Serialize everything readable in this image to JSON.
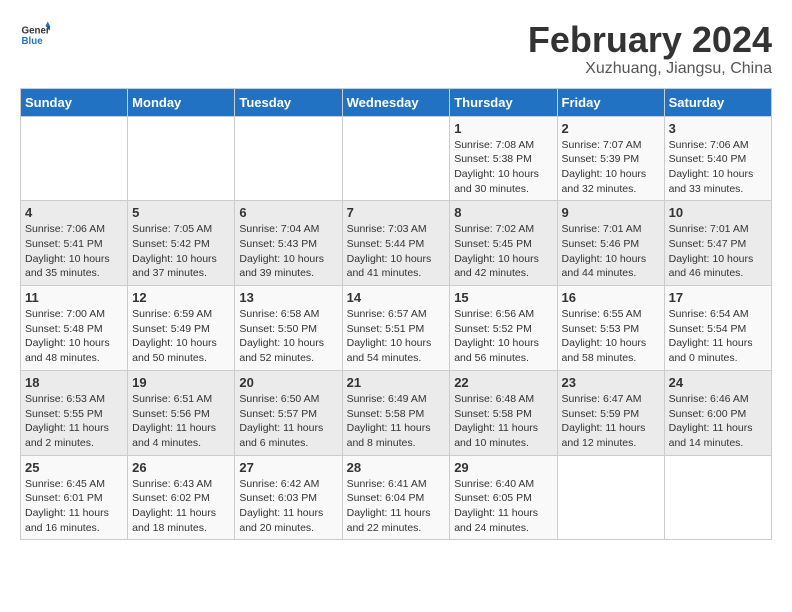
{
  "logo": {
    "text_general": "General",
    "text_blue": "Blue"
  },
  "header": {
    "title": "February 2024",
    "subtitle": "Xuzhuang, Jiangsu, China"
  },
  "days_of_week": [
    "Sunday",
    "Monday",
    "Tuesday",
    "Wednesday",
    "Thursday",
    "Friday",
    "Saturday"
  ],
  "weeks": [
    [
      {
        "day": "",
        "info": ""
      },
      {
        "day": "",
        "info": ""
      },
      {
        "day": "",
        "info": ""
      },
      {
        "day": "",
        "info": ""
      },
      {
        "day": "1",
        "info": "Sunrise: 7:08 AM\nSunset: 5:38 PM\nDaylight: 10 hours\nand 30 minutes."
      },
      {
        "day": "2",
        "info": "Sunrise: 7:07 AM\nSunset: 5:39 PM\nDaylight: 10 hours\nand 32 minutes."
      },
      {
        "day": "3",
        "info": "Sunrise: 7:06 AM\nSunset: 5:40 PM\nDaylight: 10 hours\nand 33 minutes."
      }
    ],
    [
      {
        "day": "4",
        "info": "Sunrise: 7:06 AM\nSunset: 5:41 PM\nDaylight: 10 hours\nand 35 minutes."
      },
      {
        "day": "5",
        "info": "Sunrise: 7:05 AM\nSunset: 5:42 PM\nDaylight: 10 hours\nand 37 minutes."
      },
      {
        "day": "6",
        "info": "Sunrise: 7:04 AM\nSunset: 5:43 PM\nDaylight: 10 hours\nand 39 minutes."
      },
      {
        "day": "7",
        "info": "Sunrise: 7:03 AM\nSunset: 5:44 PM\nDaylight: 10 hours\nand 41 minutes."
      },
      {
        "day": "8",
        "info": "Sunrise: 7:02 AM\nSunset: 5:45 PM\nDaylight: 10 hours\nand 42 minutes."
      },
      {
        "day": "9",
        "info": "Sunrise: 7:01 AM\nSunset: 5:46 PM\nDaylight: 10 hours\nand 44 minutes."
      },
      {
        "day": "10",
        "info": "Sunrise: 7:01 AM\nSunset: 5:47 PM\nDaylight: 10 hours\nand 46 minutes."
      }
    ],
    [
      {
        "day": "11",
        "info": "Sunrise: 7:00 AM\nSunset: 5:48 PM\nDaylight: 10 hours\nand 48 minutes."
      },
      {
        "day": "12",
        "info": "Sunrise: 6:59 AM\nSunset: 5:49 PM\nDaylight: 10 hours\nand 50 minutes."
      },
      {
        "day": "13",
        "info": "Sunrise: 6:58 AM\nSunset: 5:50 PM\nDaylight: 10 hours\nand 52 minutes."
      },
      {
        "day": "14",
        "info": "Sunrise: 6:57 AM\nSunset: 5:51 PM\nDaylight: 10 hours\nand 54 minutes."
      },
      {
        "day": "15",
        "info": "Sunrise: 6:56 AM\nSunset: 5:52 PM\nDaylight: 10 hours\nand 56 minutes."
      },
      {
        "day": "16",
        "info": "Sunrise: 6:55 AM\nSunset: 5:53 PM\nDaylight: 10 hours\nand 58 minutes."
      },
      {
        "day": "17",
        "info": "Sunrise: 6:54 AM\nSunset: 5:54 PM\nDaylight: 11 hours\nand 0 minutes."
      }
    ],
    [
      {
        "day": "18",
        "info": "Sunrise: 6:53 AM\nSunset: 5:55 PM\nDaylight: 11 hours\nand 2 minutes."
      },
      {
        "day": "19",
        "info": "Sunrise: 6:51 AM\nSunset: 5:56 PM\nDaylight: 11 hours\nand 4 minutes."
      },
      {
        "day": "20",
        "info": "Sunrise: 6:50 AM\nSunset: 5:57 PM\nDaylight: 11 hours\nand 6 minutes."
      },
      {
        "day": "21",
        "info": "Sunrise: 6:49 AM\nSunset: 5:58 PM\nDaylight: 11 hours\nand 8 minutes."
      },
      {
        "day": "22",
        "info": "Sunrise: 6:48 AM\nSunset: 5:58 PM\nDaylight: 11 hours\nand 10 minutes."
      },
      {
        "day": "23",
        "info": "Sunrise: 6:47 AM\nSunset: 5:59 PM\nDaylight: 11 hours\nand 12 minutes."
      },
      {
        "day": "24",
        "info": "Sunrise: 6:46 AM\nSunset: 6:00 PM\nDaylight: 11 hours\nand 14 minutes."
      }
    ],
    [
      {
        "day": "25",
        "info": "Sunrise: 6:45 AM\nSunset: 6:01 PM\nDaylight: 11 hours\nand 16 minutes."
      },
      {
        "day": "26",
        "info": "Sunrise: 6:43 AM\nSunset: 6:02 PM\nDaylight: 11 hours\nand 18 minutes."
      },
      {
        "day": "27",
        "info": "Sunrise: 6:42 AM\nSunset: 6:03 PM\nDaylight: 11 hours\nand 20 minutes."
      },
      {
        "day": "28",
        "info": "Sunrise: 6:41 AM\nSunset: 6:04 PM\nDaylight: 11 hours\nand 22 minutes."
      },
      {
        "day": "29",
        "info": "Sunrise: 6:40 AM\nSunset: 6:05 PM\nDaylight: 11 hours\nand 24 minutes."
      },
      {
        "day": "",
        "info": ""
      },
      {
        "day": "",
        "info": ""
      }
    ]
  ]
}
